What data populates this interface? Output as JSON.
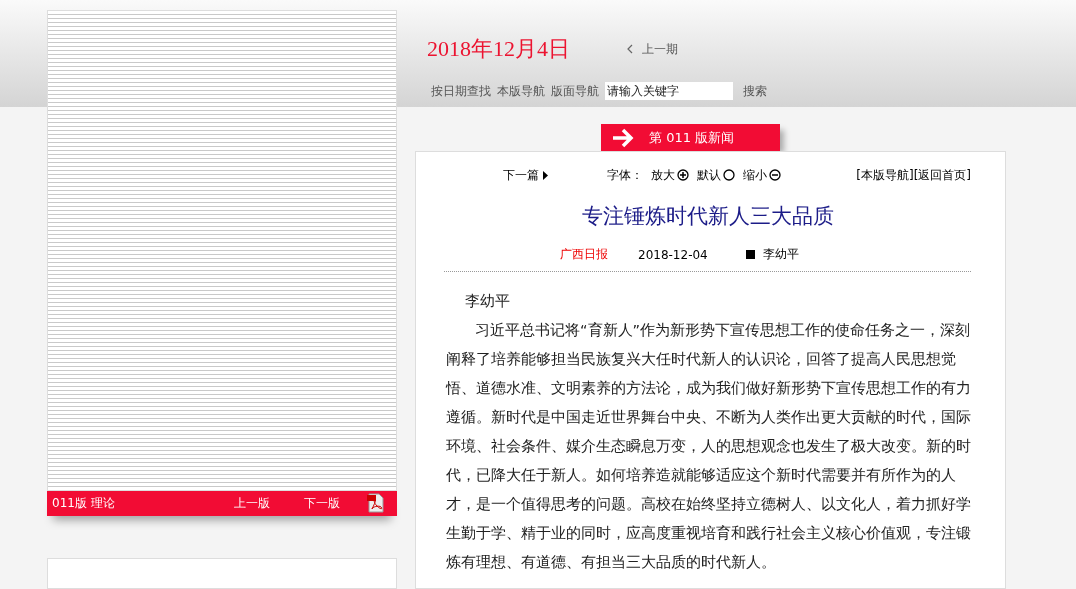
{
  "page_image": {
    "caption": "011版 理论",
    "prev": "上一版",
    "next": "下一版"
  },
  "header": {
    "date": "2018年12月4日",
    "prev_issue": "上一期",
    "nav": [
      "按日期查找",
      "本版导航",
      "版面导航"
    ],
    "search": {
      "value": "请输入关键字",
      "button": "搜索"
    }
  },
  "section_banner": "第 011 版新闻",
  "toolbar": {
    "next_article": "下一篇",
    "font_label": "字体：",
    "font_options": [
      {
        "label": "放大",
        "kind": "plus"
      },
      {
        "label": "默认",
        "kind": "default"
      },
      {
        "label": "缩小",
        "kind": "minus"
      }
    ],
    "links": [
      "[本版导航]",
      "[返回首页]"
    ]
  },
  "article": {
    "title": "专注锤炼时代新人三大品质",
    "source": "广西日报",
    "date": "2018-12-04",
    "author": "李幼平",
    "paragraphs": [
      "李幼平",
      "习近平总书记将“育新人”作为新形势下宣传思想工作的使命任务之一，深刻阐释了培养能够担当民族复兴大任时代新人的认识论，回答了提高人民思想觉悟、道德水准、文明素养的方法论，成为我们做好新形势下宣传思想工作的有力遵循。新时代是中国走近世界舞台中央、不断为人类作出更大贡献的时代，国际环境、社会条件、媒介生态瞬息万变，人的思想观念也发生了极大改变。新的时代，已降大任于新人。如何培养造就能够适应这个新时代需要并有所作为的人才，是一个值得思考的问题。高校在始终坚持立德树人、以文化人，着力抓好学生勤于学、精于业的同时，应高度重视培育和践行社会主义核心价值观，专注锻炼有理想、有道德、有担当三大品质的时代新人。"
    ]
  }
}
